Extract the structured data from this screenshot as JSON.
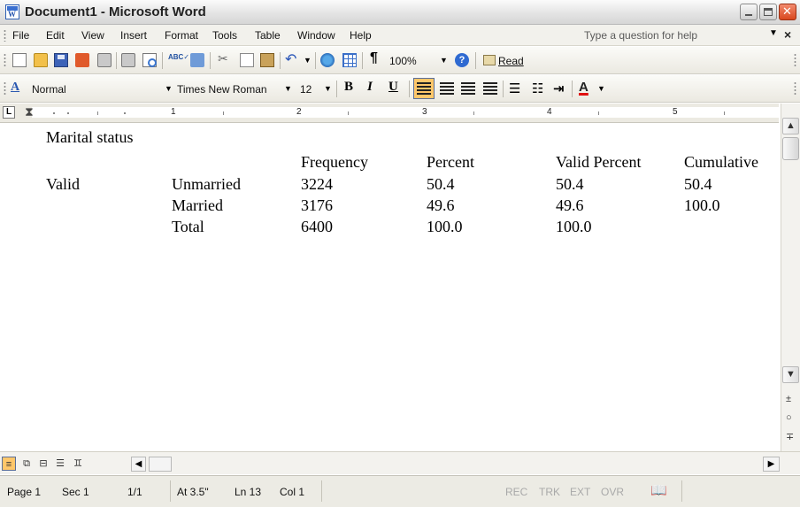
{
  "window": {
    "title": "Document1 - Microsoft Word",
    "app_icon_letter": "W"
  },
  "menubar": {
    "items": [
      "File",
      "Edit",
      "View",
      "Insert",
      "Format",
      "Tools",
      "Table",
      "Window",
      "Help"
    ],
    "help_placeholder": "Type a question for help"
  },
  "standard_toolbar": {
    "zoom": "100%",
    "read_label": "Read"
  },
  "formatting_toolbar": {
    "style": "Normal",
    "font": "Times New Roman",
    "size": "12",
    "bold": "B",
    "italic": "I",
    "underline": "U",
    "font_color_glyph": "A",
    "style_icon_glyph": "A"
  },
  "ruler": {
    "numbers": [
      "1",
      "2",
      "3",
      "4",
      "5"
    ]
  },
  "document": {
    "table_title": "Marital status",
    "headers": [
      "Frequency",
      "Percent",
      "Valid Percent",
      "Cumulative"
    ],
    "group_label": "Valid",
    "rows": [
      {
        "label": "Unmarried",
        "frequency": "3224",
        "percent": "50.4",
        "valid_percent": "50.4",
        "cumulative": "50.4"
      },
      {
        "label": "Married",
        "frequency": "3176",
        "percent": "49.6",
        "valid_percent": "49.6",
        "cumulative": "100.0"
      },
      {
        "label": "Total",
        "frequency": "6400",
        "percent": "100.0",
        "valid_percent": "100.0",
        "cumulative": ""
      }
    ]
  },
  "statusbar": {
    "page": "Page 1",
    "section": "Sec 1",
    "page_of": "1/1",
    "at": "At 3.5\"",
    "line": "Ln 13",
    "col": "Col 1",
    "rec": "REC",
    "trk": "TRK",
    "ext": "EXT",
    "ovr": "OVR"
  },
  "colors": {
    "selected_button": "#ffc76a",
    "font_color_underline": "#e01010",
    "close_button": "#d9481f"
  },
  "icons": [
    "app-word-icon",
    "minimize-icon",
    "maximize-icon",
    "close-icon",
    "new-document-icon",
    "open-icon",
    "save-icon",
    "permission-icon",
    "print-icon",
    "print-preview-icon",
    "spelling-icon",
    "research-icon",
    "cut-icon",
    "copy-icon",
    "paste-icon",
    "undo-icon",
    "hyperlink-icon",
    "insert-table-icon",
    "show-formatting-icon",
    "help-icon",
    "read-icon",
    "styles-icon",
    "align-left-icon",
    "center-icon",
    "align-right-icon",
    "justify-icon",
    "numbering-icon",
    "bullets-icon",
    "increase-indent-icon",
    "font-color-icon",
    "spelling-status-icon"
  ]
}
